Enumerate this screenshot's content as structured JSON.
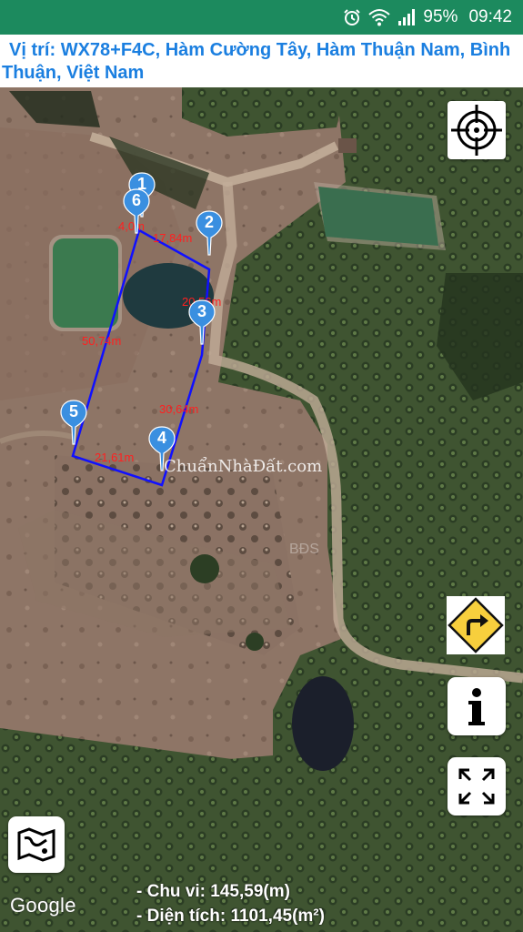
{
  "status_bar": {
    "battery": "95%",
    "time": "09:42",
    "icons": [
      "alarm-icon",
      "wifi-icon",
      "signal-icon"
    ]
  },
  "location": {
    "prefix": "Vị trí:",
    "text": "WX78+F4C, Hàm Cường Tây, Hàm Thuận Nam, Bình Thuận, Việt Nam"
  },
  "markers": [
    {
      "label": "1"
    },
    {
      "label": "2"
    },
    {
      "label": "3"
    },
    {
      "label": "4"
    },
    {
      "label": "5"
    },
    {
      "label": "6"
    }
  ],
  "dimensions": [
    "4,0m",
    "17,84m",
    "20,56m",
    "50,74m",
    "30,64m",
    "21,61m"
  ],
  "watermark": {
    "text": "ChuẩnNhàĐất.com",
    "faint": "BĐS"
  },
  "buttons": {
    "locate": "target-icon",
    "directions": "turn-right-icon",
    "info": "info-icon",
    "fullscreen": "expand-icon",
    "map_type": "map-icon"
  },
  "stats": {
    "perimeter": "- Chu vi: 145,59(m)",
    "area": "- Diện tích: 1101,45(m²)"
  },
  "attribution": "Google",
  "colors": {
    "status_bar": "#1c8a5e",
    "location_text": "#1b7fe0",
    "polygon": "#1010ff",
    "marker": "#3a8fe0",
    "dimension_text": "#ff2020"
  }
}
